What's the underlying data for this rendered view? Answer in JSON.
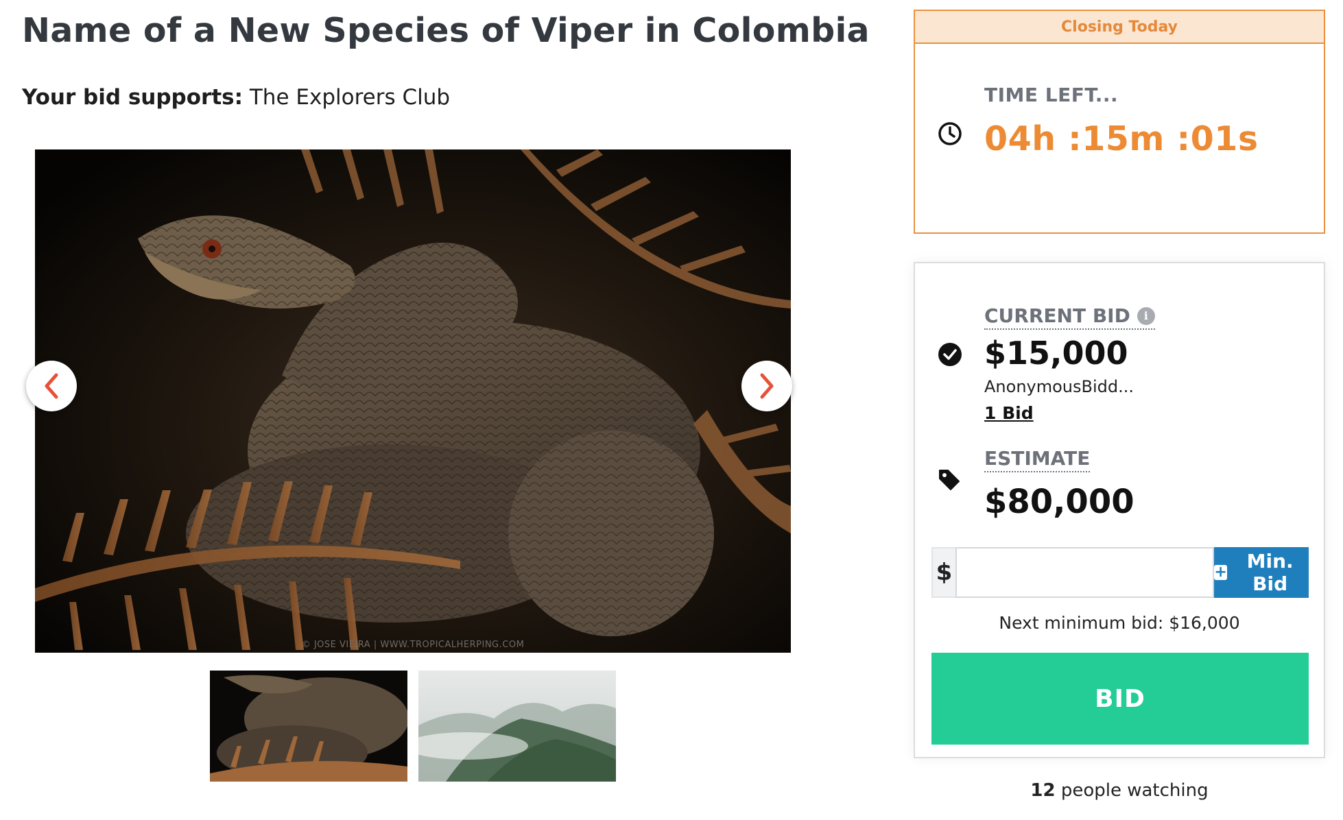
{
  "item": {
    "title": "Name of a New Species of Viper in Colombia",
    "supports_label": "Your bid supports:",
    "supports_org": "The Explorers Club",
    "image_credit": "© JOSE VIEIRA | WWW.TROPICALHERPING.COM"
  },
  "gallery": {
    "prev_icon": "chevron-left-icon",
    "next_icon": "chevron-right-icon",
    "arrow_color": "#e8503a",
    "thumbnails": [
      "viper",
      "misty-forest"
    ]
  },
  "timer": {
    "header": "Closing Today",
    "label": "TIME LEFT...",
    "value": "04h :15m :01s",
    "icon": "clock-icon",
    "accent": "#ed8a34"
  },
  "bidding": {
    "current_label": "CURRENT BID",
    "current_value": "$15,000",
    "bidder": "AnonymousBidd...",
    "bid_count": "1 Bid",
    "estimate_label": "ESTIMATE",
    "estimate_value": "$80,000",
    "currency_symbol": "$",
    "input_value": "",
    "min_bid_label": "Min. Bid",
    "next_min_label": "Next minimum bid:",
    "next_min_value": "$16,000",
    "bid_button": "BID",
    "bid_button_color": "#24cc96",
    "min_button_color": "#1f7fbd"
  },
  "watching": {
    "count": "12",
    "label": "people watching"
  }
}
